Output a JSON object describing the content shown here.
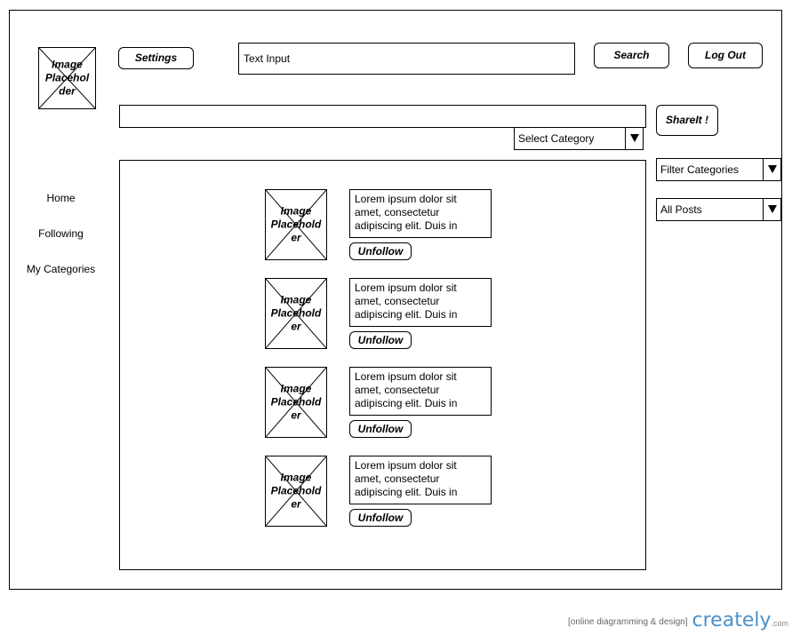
{
  "header": {
    "logo_label": "Image Placehol der",
    "settings_label": "Settings",
    "search_input_value": "Text Input",
    "search_label": "Search",
    "logout_label": "Log Out"
  },
  "share": {
    "share_label": "ShareIt !",
    "category_select": "Select Category"
  },
  "sidebar": {
    "items": [
      {
        "label": "Home"
      },
      {
        "label": "Following"
      },
      {
        "label": "My Categories"
      }
    ]
  },
  "filters": {
    "filter_categories": "Filter Categories",
    "all_posts": "All Posts"
  },
  "feed": {
    "items": [
      {
        "image_label": "Image Placehold er",
        "text": "Lorem ipsum dolor sit amet, consectetur adipiscing elit. Duis in",
        "unfollow_label": "Unfollow"
      },
      {
        "image_label": "Image Placehold er",
        "text": "Lorem ipsum dolor sit amet, consectetur adipiscing elit. Duis in",
        "unfollow_label": "Unfollow"
      },
      {
        "image_label": "Image Placehold er",
        "text": "Lorem ipsum dolor sit amet, consectetur adipiscing elit. Duis in",
        "unfollow_label": "Unfollow"
      },
      {
        "image_label": "Image Placehold er",
        "text": "Lorem ipsum dolor sit amet, consectetur adipiscing elit. Duis in",
        "unfollow_label": "Unfollow"
      }
    ]
  },
  "footer": {
    "tagline": "[online diagramming & design]",
    "brand": "creately",
    "suffix": ".com",
    "brand_color": "#4a90c8"
  }
}
